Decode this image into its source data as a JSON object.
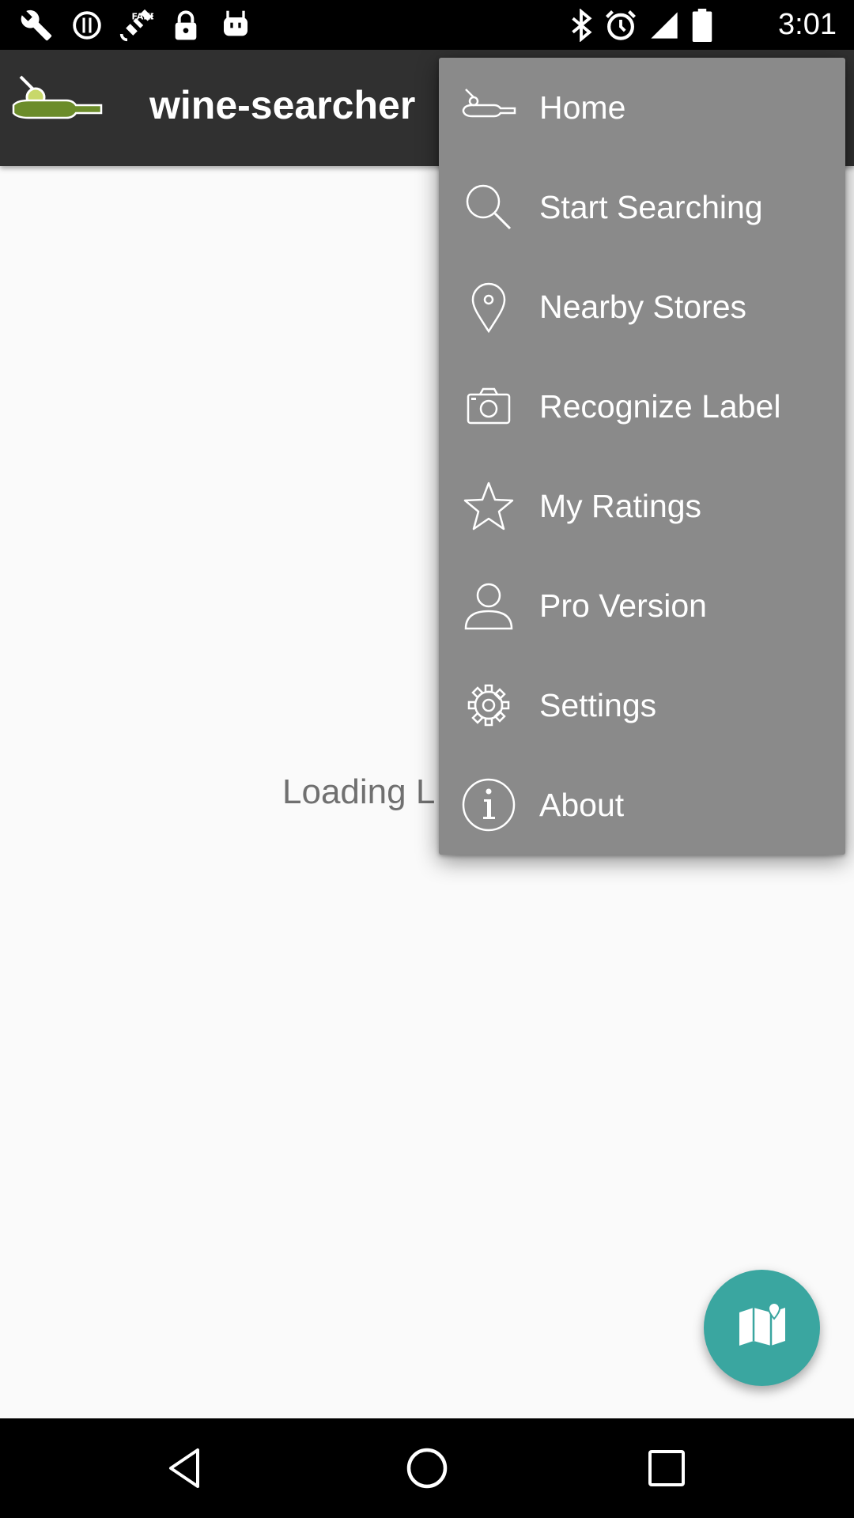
{
  "status_bar": {
    "time": "3:01",
    "left_icons": [
      "wrench-icon",
      "alert-circle-icon",
      "fake-gps-satellite-icon",
      "lock-icon",
      "android-icon"
    ],
    "right_icons": [
      "bluetooth-icon",
      "alarm-icon",
      "signal-icon",
      "battery-icon"
    ]
  },
  "app_bar": {
    "title": "wine-searcher",
    "logo_icon": "wine-bottle-logo-icon",
    "background": "#303030"
  },
  "main": {
    "loading_text": "Loading L"
  },
  "menu": {
    "background": "#8a8a8a",
    "items": [
      {
        "label": "Home",
        "icon": "wine-bottle-icon"
      },
      {
        "label": "Start Searching",
        "icon": "search-icon"
      },
      {
        "label": "Nearby Stores",
        "icon": "location-pin-icon"
      },
      {
        "label": "Recognize Label",
        "icon": "camera-icon"
      },
      {
        "label": "My Ratings",
        "icon": "star-icon"
      },
      {
        "label": "Pro Version",
        "icon": "person-icon"
      },
      {
        "label": "Settings",
        "icon": "gear-icon"
      },
      {
        "label": "About",
        "icon": "info-icon"
      }
    ]
  },
  "fab": {
    "icon": "map-icon",
    "color": "#3aa6a0"
  },
  "nav_bar": {
    "buttons": [
      "back-icon",
      "home-icon",
      "recents-icon"
    ]
  }
}
